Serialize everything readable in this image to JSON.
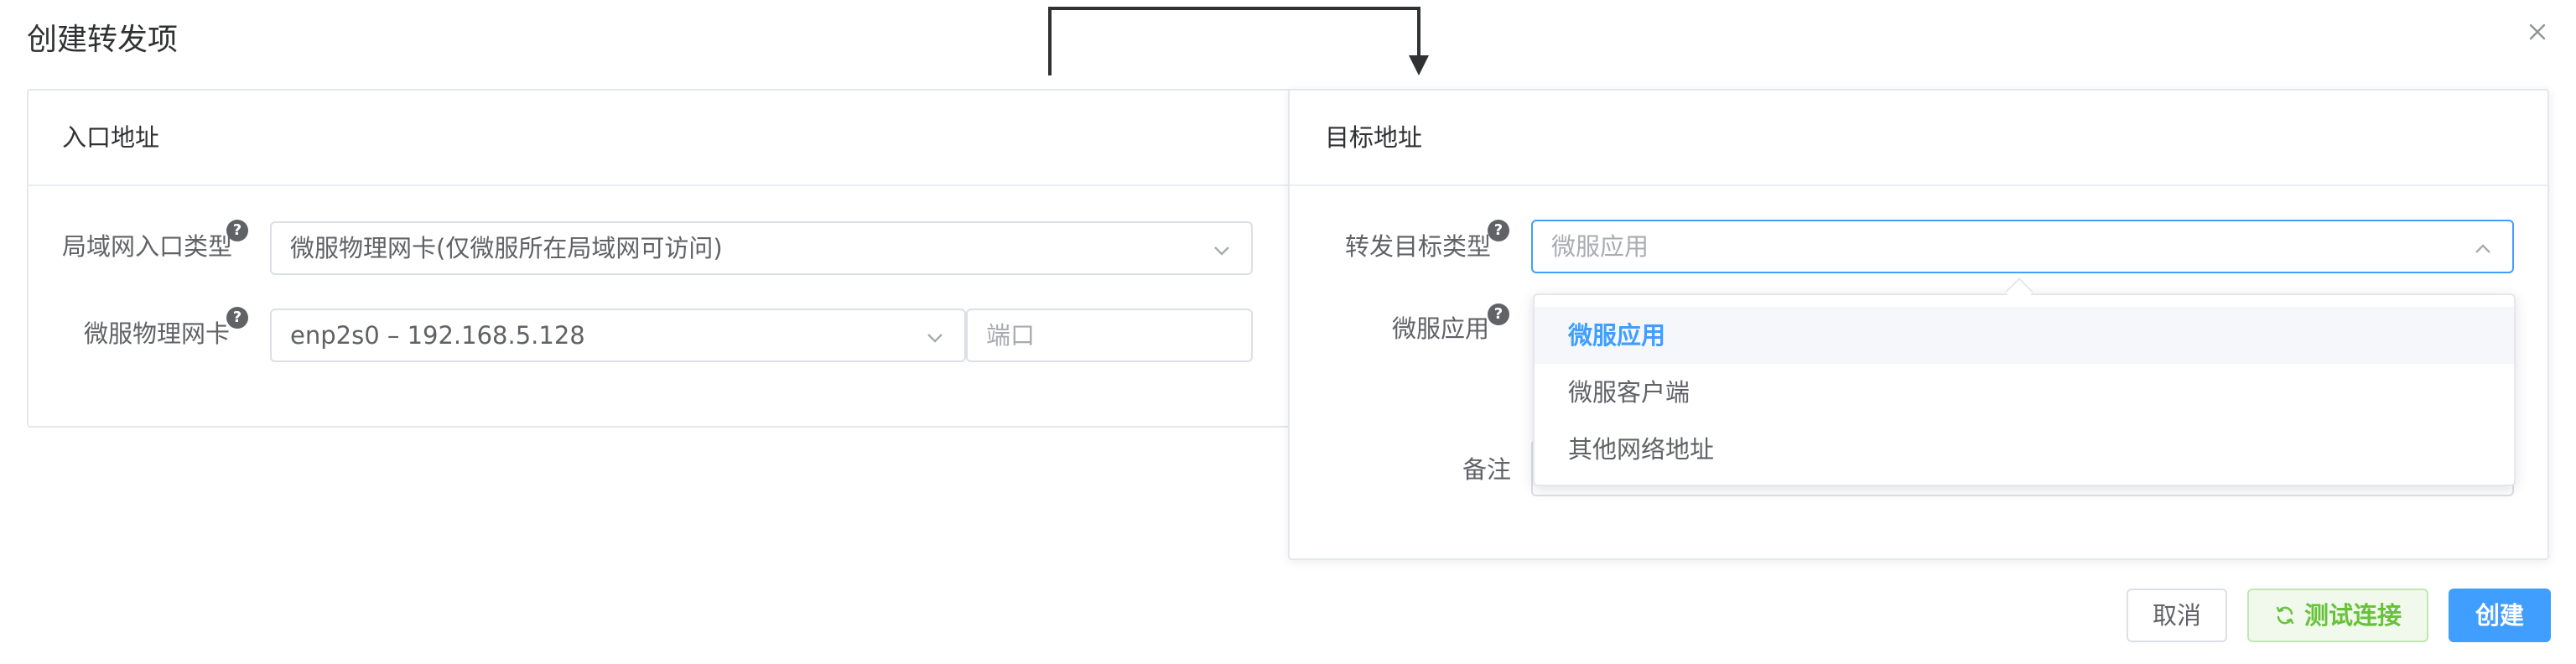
{
  "dialog": {
    "title": "创建转发项"
  },
  "entry": {
    "header": "入口地址",
    "lan_type_label": "局域网入口类型",
    "lan_type_value": "微服物理网卡(仅微服所在局域网可访问)",
    "nic_label": "微服物理网卡",
    "nic_value": "enp2s0 – 192.168.5.128",
    "port_placeholder": "端口"
  },
  "target": {
    "header": "目标地址",
    "type_label": "转发目标类型",
    "type_placeholder": "微服应用",
    "app_label": "微服应用",
    "note_label": "备注"
  },
  "dropdown": {
    "options": [
      "微服应用",
      "微服客户端",
      "其他网络地址"
    ],
    "selected_index": 0
  },
  "help_icon_glyph": "?",
  "buttons": {
    "cancel": "取消",
    "test": "测试连接",
    "create": "创建"
  },
  "colors": {
    "primary": "#409eff",
    "success": "#67c23a",
    "success_bg": "#f0f9eb",
    "border": "#dcdfe6",
    "text": "#606266"
  },
  "icons": {
    "close": "close-icon",
    "help": "question-circle-icon",
    "chevron_down": "chevron-down-icon",
    "chevron_up": "chevron-up-icon",
    "refresh": "refresh-icon"
  }
}
